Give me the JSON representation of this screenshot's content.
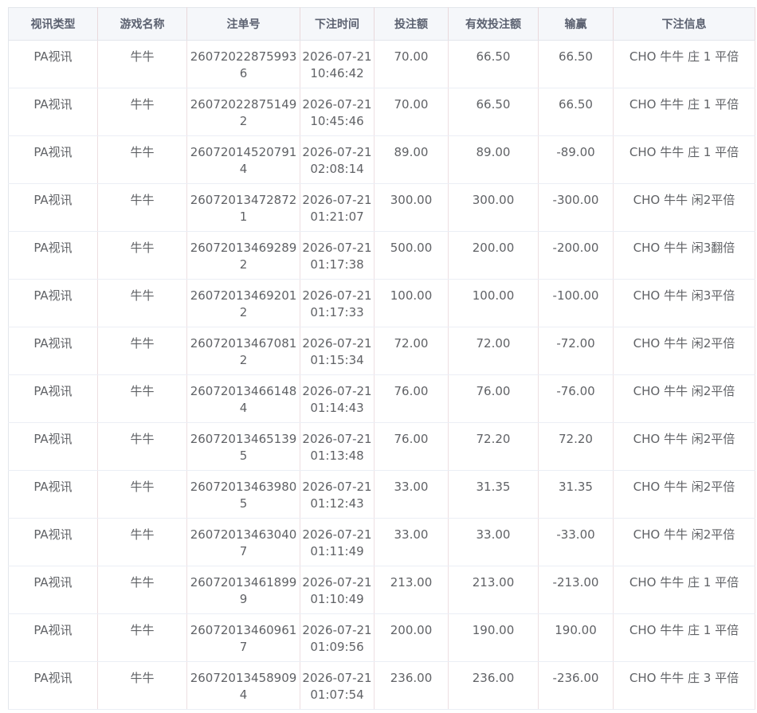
{
  "table": {
    "columns": [
      "视讯类型",
      "游戏名称",
      "注单号",
      "下注时间",
      "投注额",
      "有效投注额",
      "输赢",
      "下注信息"
    ],
    "rows": [
      {
        "type": "PA视讯",
        "game": "牛牛",
        "order_no": "260720228759936",
        "time": "2026-07-21 10:46:42",
        "bet": "70.00",
        "valid_bet": "66.50",
        "win_loss": "66.50",
        "info": "CHO 牛牛 庄 1 平倍"
      },
      {
        "type": "PA视讯",
        "game": "牛牛",
        "order_no": "260720228751492",
        "time": "2026-07-21 10:45:46",
        "bet": "70.00",
        "valid_bet": "66.50",
        "win_loss": "66.50",
        "info": "CHO 牛牛 庄 1 平倍"
      },
      {
        "type": "PA视讯",
        "game": "牛牛",
        "order_no": "260720145207914",
        "time": "2026-07-21 02:08:14",
        "bet": "89.00",
        "valid_bet": "89.00",
        "win_loss": "-89.00",
        "info": "CHO 牛牛 庄 1 平倍"
      },
      {
        "type": "PA视讯",
        "game": "牛牛",
        "order_no": "260720134728721",
        "time": "2026-07-21 01:21:07",
        "bet": "300.00",
        "valid_bet": "300.00",
        "win_loss": "-300.00",
        "info": "CHO 牛牛 闲2平倍"
      },
      {
        "type": "PA视讯",
        "game": "牛牛",
        "order_no": "260720134692892",
        "time": "2026-07-21 01:17:38",
        "bet": "500.00",
        "valid_bet": "200.00",
        "win_loss": "-200.00",
        "info": "CHO 牛牛 闲3翻倍"
      },
      {
        "type": "PA视讯",
        "game": "牛牛",
        "order_no": "260720134692012",
        "time": "2026-07-21 01:17:33",
        "bet": "100.00",
        "valid_bet": "100.00",
        "win_loss": "-100.00",
        "info": "CHO 牛牛 闲3平倍"
      },
      {
        "type": "PA视讯",
        "game": "牛牛",
        "order_no": "260720134670812",
        "time": "2026-07-21 01:15:34",
        "bet": "72.00",
        "valid_bet": "72.00",
        "win_loss": "-72.00",
        "info": "CHO 牛牛 闲2平倍"
      },
      {
        "type": "PA视讯",
        "game": "牛牛",
        "order_no": "260720134661484",
        "time": "2026-07-21 01:14:43",
        "bet": "76.00",
        "valid_bet": "76.00",
        "win_loss": "-76.00",
        "info": "CHO 牛牛 闲2平倍"
      },
      {
        "type": "PA视讯",
        "game": "牛牛",
        "order_no": "260720134651395",
        "time": "2026-07-21 01:13:48",
        "bet": "76.00",
        "valid_bet": "72.20",
        "win_loss": "72.20",
        "info": "CHO 牛牛 闲2平倍"
      },
      {
        "type": "PA视讯",
        "game": "牛牛",
        "order_no": "260720134639805",
        "time": "2026-07-21 01:12:43",
        "bet": "33.00",
        "valid_bet": "31.35",
        "win_loss": "31.35",
        "info": "CHO 牛牛 闲2平倍"
      },
      {
        "type": "PA视讯",
        "game": "牛牛",
        "order_no": "260720134630407",
        "time": "2026-07-21 01:11:49",
        "bet": "33.00",
        "valid_bet": "33.00",
        "win_loss": "-33.00",
        "info": "CHO 牛牛 闲2平倍"
      },
      {
        "type": "PA视讯",
        "game": "牛牛",
        "order_no": "260720134618999",
        "time": "2026-07-21 01:10:49",
        "bet": "213.00",
        "valid_bet": "213.00",
        "win_loss": "-213.00",
        "info": "CHO 牛牛 庄 1 平倍"
      },
      {
        "type": "PA视讯",
        "game": "牛牛",
        "order_no": "260720134609617",
        "time": "2026-07-21 01:09:56",
        "bet": "200.00",
        "valid_bet": "190.00",
        "win_loss": "190.00",
        "info": "CHO 牛牛 庄 1 平倍"
      },
      {
        "type": "PA视讯",
        "game": "牛牛",
        "order_no": "260720134589094",
        "time": "2026-07-21 01:07:54",
        "bet": "236.00",
        "valid_bet": "236.00",
        "win_loss": "-236.00",
        "info": "CHO 牛牛 庄 3 平倍"
      }
    ]
  }
}
